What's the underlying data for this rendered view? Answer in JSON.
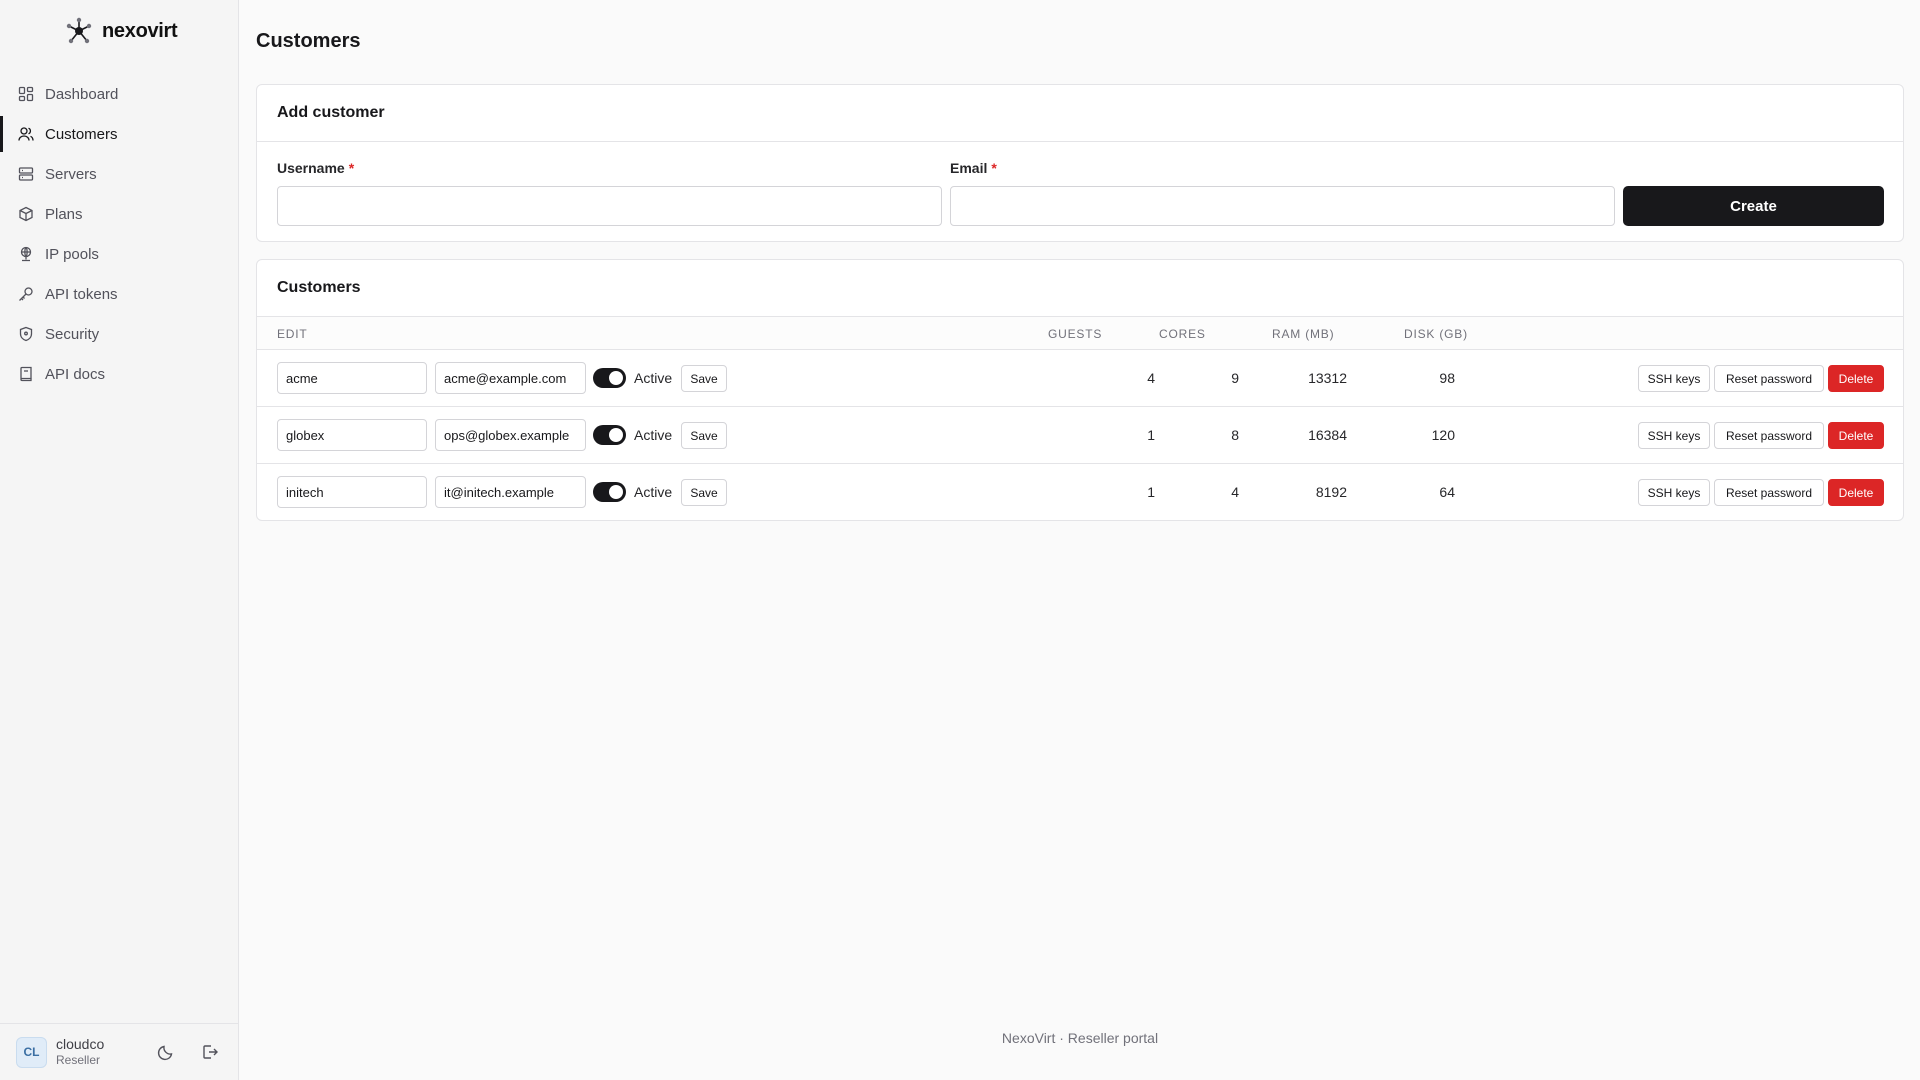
{
  "brand": {
    "name": "nexovirt"
  },
  "sidebar": {
    "items": [
      {
        "label": "Dashboard",
        "icon": "dashboard-icon",
        "active": false
      },
      {
        "label": "Customers",
        "icon": "users-icon",
        "active": true
      },
      {
        "label": "Servers",
        "icon": "server-icon",
        "active": false
      },
      {
        "label": "Plans",
        "icon": "box-icon",
        "active": false
      },
      {
        "label": "IP pools",
        "icon": "network-icon",
        "active": false
      },
      {
        "label": "API tokens",
        "icon": "key-icon",
        "active": false
      },
      {
        "label": "Security",
        "icon": "shield-icon",
        "active": false
      },
      {
        "label": "API docs",
        "icon": "book-icon",
        "active": false
      }
    ]
  },
  "user": {
    "initials": "CL",
    "name": "cloudco",
    "role": "Reseller"
  },
  "page": {
    "title": "Customers"
  },
  "add_form": {
    "title": "Add customer",
    "username_label": "Username",
    "email_label": "Email",
    "required_mark": "*",
    "username_value": "",
    "email_value": "",
    "create_label": "Create"
  },
  "table": {
    "title": "Customers",
    "headers": {
      "edit": "EDIT",
      "guests": "GUESTS",
      "cores": "CORES",
      "ram": "RAM (MB)",
      "disk": "DISK (GB)"
    },
    "rows": [
      {
        "username": "acme",
        "email": "acme@example.com",
        "active": true,
        "status": "Active",
        "guests": "4",
        "cores": "9",
        "ram": "13312",
        "disk": "98"
      },
      {
        "username": "globex",
        "email": "ops@globex.example",
        "active": true,
        "status": "Active",
        "guests": "1",
        "cores": "8",
        "ram": "16384",
        "disk": "120"
      },
      {
        "username": "initech",
        "email": "it@initech.example",
        "active": true,
        "status": "Active",
        "guests": "1",
        "cores": "4",
        "ram": "8192",
        "disk": "64"
      }
    ],
    "actions": {
      "save": "Save",
      "ssh_keys": "SSH keys",
      "reset_password": "Reset password",
      "delete": "Delete"
    }
  },
  "footer": {
    "text": "NexoVirt · Reseller portal"
  },
  "colors": {
    "accent": "#18181b",
    "danger": "#dc2626",
    "sidebar_bg": "#f5f5f5",
    "page_bg": "#fafafa"
  }
}
